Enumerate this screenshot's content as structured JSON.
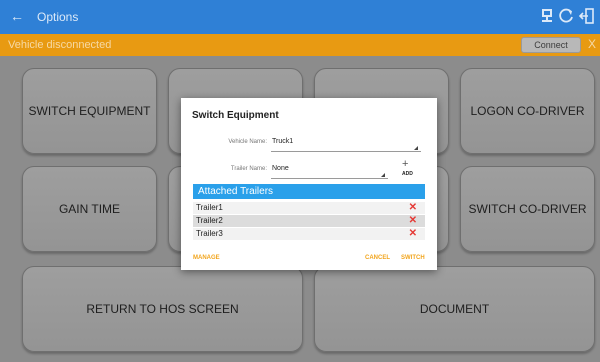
{
  "header": {
    "title": "Options",
    "icons": [
      "back-arrow-icon",
      "device-icon",
      "refresh-icon",
      "logout-icon"
    ]
  },
  "status": {
    "message": "Vehicle disconnected",
    "connect_label": "Connect",
    "close_label": "X"
  },
  "tiles": {
    "switch_equipment": "SWITCH EQUIPMENT",
    "logon_co_driver": "LOGON CO-DRIVER",
    "gain_time": "GAIN TIME",
    "switch_co_driver": "SWITCH CO-DRIVER",
    "return_to_hos": "RETURN TO HOS SCREEN",
    "document": "DOCUMENT"
  },
  "dialog": {
    "title": "Switch Equipment",
    "vehicle_label": "Vehicle Name:",
    "vehicle_value": "Truck1",
    "trailer_label": "Trailer Name:",
    "trailer_value": "None",
    "add_label": "ADD",
    "attached_header": "Attached Trailers",
    "trailers": [
      "Trailer1",
      "Trailer2",
      "Trailer3"
    ],
    "manage_label": "MANAGE",
    "cancel_label": "CANCEL",
    "switch_label": "SWITCH"
  },
  "colors": {
    "appbar": "#2f80d6",
    "statusbar": "#e89a12",
    "accent": "#2aa0ea",
    "action": "#f2a51d",
    "delete": "#e53935"
  }
}
